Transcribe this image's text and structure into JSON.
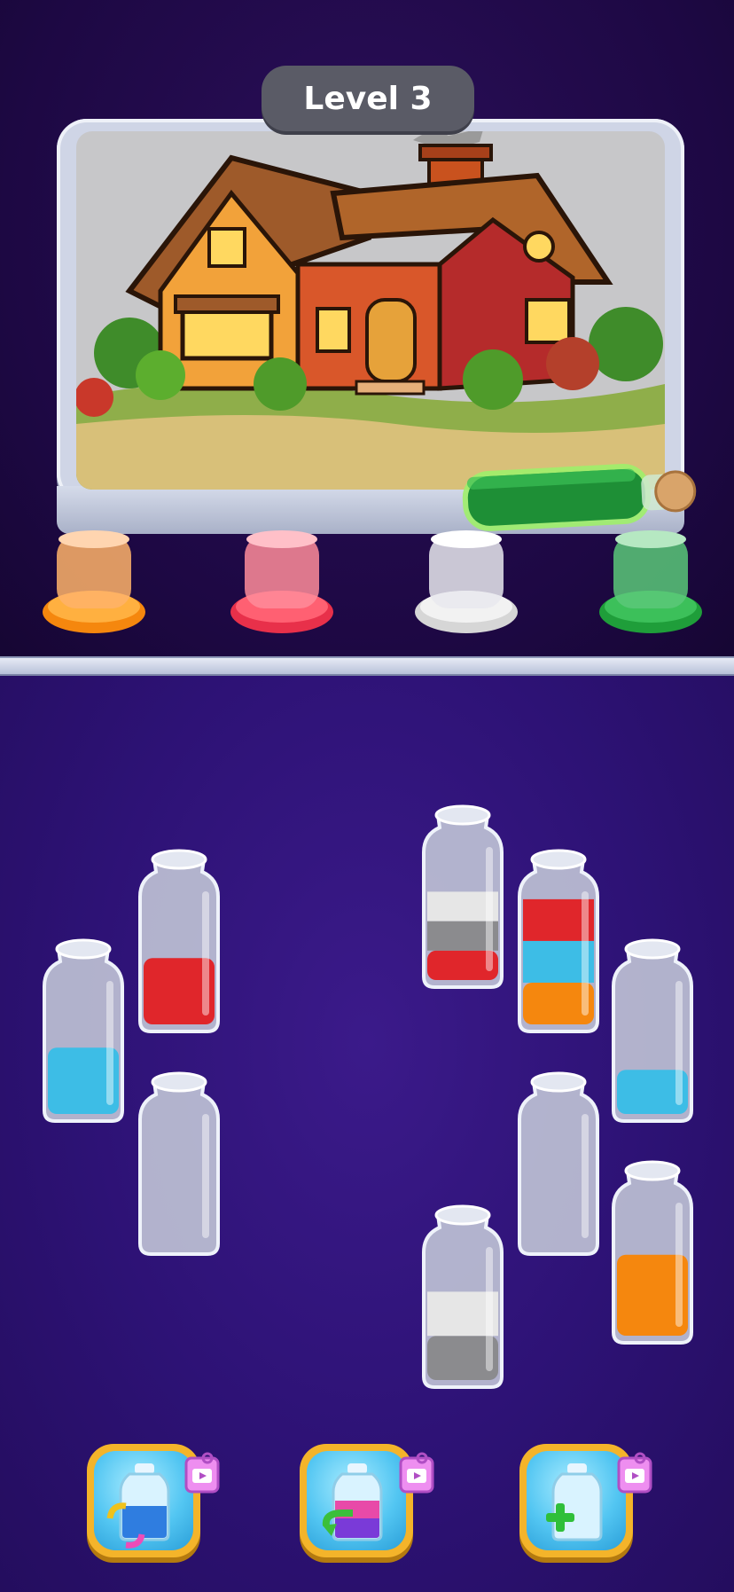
{
  "header": {
    "level_label": "Level 3"
  },
  "palette": {
    "red": "#e0262b",
    "blue": "#3dbde6",
    "orange": "#f5870e",
    "grey": "#8b8b8e",
    "white": "#e6e6e6",
    "green": "#1f9e3a",
    "pink": "#ef4a5c"
  },
  "pots": [
    {
      "color": "orange"
    },
    {
      "color": "pink"
    },
    {
      "color": "white"
    },
    {
      "color": "green"
    }
  ],
  "tubes": [
    {
      "layers": [
        "blue"
      ],
      "fill_fraction": 0.45
    },
    {
      "layers": [
        "red"
      ],
      "fill_fraction": 0.45
    },
    {
      "layers": [],
      "fill_fraction": 0
    },
    {
      "layers": [
        "red",
        "grey",
        "white"
      ],
      "fill_fraction": 0.6
    },
    {
      "layers": [
        "orange",
        "blue",
        "red"
      ],
      "fill_fraction": 0.85
    },
    {
      "layers": [],
      "fill_fraction": 0
    },
    {
      "layers": [
        "blue"
      ],
      "fill_fraction": 0.3
    },
    {
      "layers": [
        "grey",
        "white"
      ],
      "fill_fraction": 0.6
    },
    {
      "layers": [
        "orange"
      ],
      "fill_fraction": 0.55
    }
  ],
  "pouring_tube": {
    "color": "green"
  },
  "tools": [
    {
      "name": "shuffle",
      "icon": "shuffle-bottle-icon",
      "badge": "video-ad-icon"
    },
    {
      "name": "undo",
      "icon": "undo-bottle-icon",
      "badge": "video-ad-icon"
    },
    {
      "name": "add-tube",
      "icon": "add-bottle-icon",
      "badge": "video-ad-icon"
    }
  ]
}
